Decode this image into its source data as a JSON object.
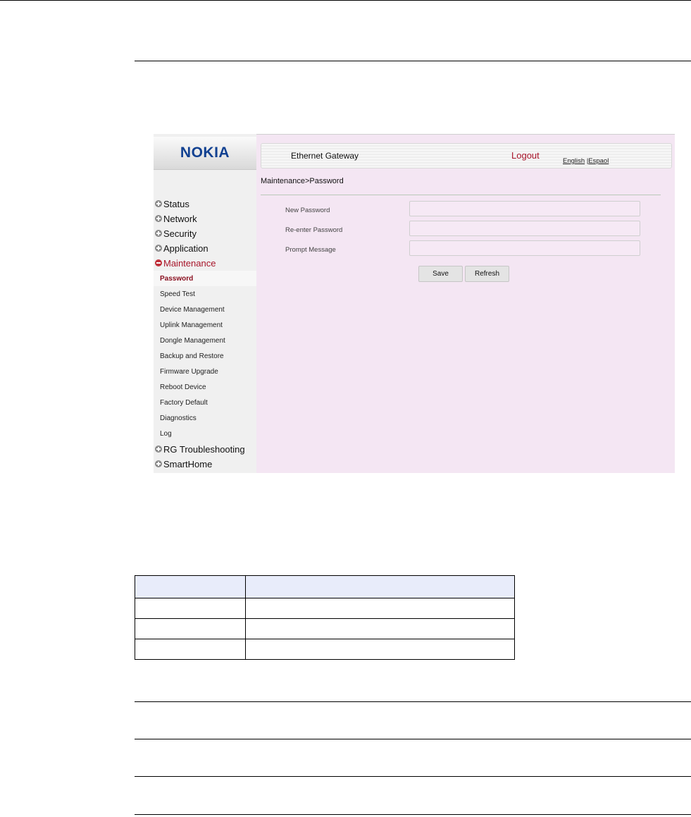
{
  "screenshot": {
    "logo": "NOKIA",
    "header": {
      "title": "Ethernet Gateway",
      "logout": "Logout",
      "lang_english": "English",
      "lang_separator": "|",
      "lang_espanol": "Espaol"
    },
    "breadcrumb": "Maintenance>Password",
    "menu": {
      "groups": [
        "Status",
        "Network",
        "Security",
        "Application",
        "Maintenance"
      ],
      "active_group": "Maintenance",
      "maintenance_items": [
        "Password",
        "Speed Test",
        "Device Management",
        "Uplink Management",
        "Dongle Management",
        "Backup and Restore",
        "Firmware Upgrade",
        "Reboot Device",
        "Factory Default",
        "Diagnostics",
        "Log"
      ],
      "active_item": "Password",
      "tail_groups": [
        "RG Troubleshooting",
        "SmartHome"
      ]
    },
    "form": {
      "new_password_label": "New Password",
      "new_password_value": "",
      "reenter_password_label": "Re-enter Password",
      "reenter_password_value": "",
      "prompt_message_label": "Prompt Message",
      "prompt_message_value": "",
      "save_label": "Save",
      "refresh_label": "Refresh"
    },
    "colors": {
      "brand": "#124191",
      "accent_red": "#a8152a",
      "content_bg": "#f4e6f3"
    }
  },
  "document": {
    "table": {
      "headers": [
        "",
        ""
      ],
      "rows": [
        [
          "",
          ""
        ],
        [
          "",
          ""
        ],
        [
          "",
          ""
        ]
      ]
    }
  }
}
